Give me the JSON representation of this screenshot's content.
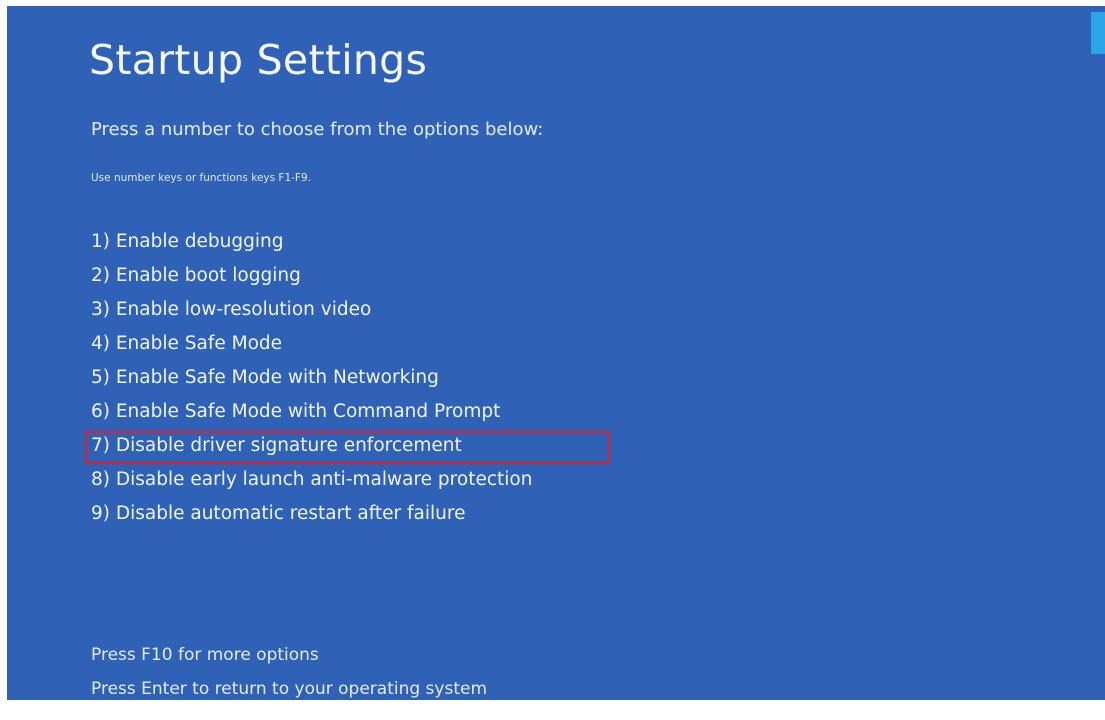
{
  "title": "Startup Settings",
  "instruction": "Press a number to choose from the options below:",
  "hint": "Use number keys or functions keys F1-F9.",
  "options": [
    {
      "label": "1) Enable debugging"
    },
    {
      "label": "2) Enable boot logging"
    },
    {
      "label": "3) Enable low-resolution video"
    },
    {
      "label": "4) Enable Safe Mode"
    },
    {
      "label": "5) Enable Safe Mode with Networking"
    },
    {
      "label": "6) Enable Safe Mode with Command Prompt"
    },
    {
      "label": "7) Disable driver signature enforcement",
      "highlighted": true
    },
    {
      "label": "8) Disable early launch anti-malware protection"
    },
    {
      "label": "9) Disable automatic restart after failure"
    }
  ],
  "footer": {
    "more_options": "Press F10 for more options",
    "return": "Press Enter to return to your operating system"
  },
  "colors": {
    "background": "#2f62b6",
    "highlight_border": "#e0212b",
    "scroll_indicator": "#29a6ea"
  }
}
